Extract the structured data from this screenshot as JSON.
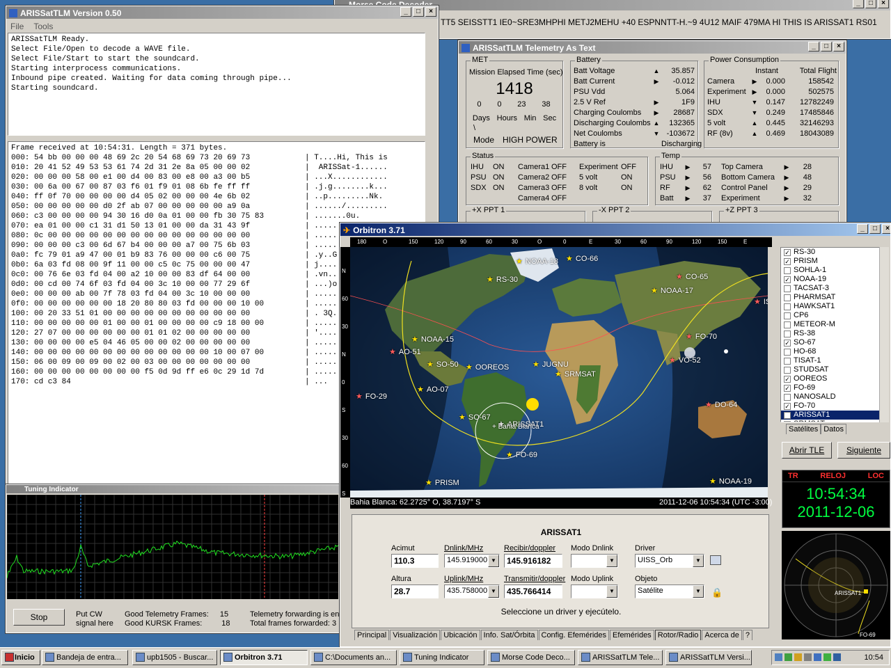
{
  "morse": {
    "title": "Morse Code Decoder",
    "text": "TT5 SEISSTT1 IE0~SRE3MHPHI METJ2MEHU +40 ESPNNTT-H.~9 4U12 MAIF 479MA HI THIS IS ARISSAT1 RS01"
  },
  "arissat": {
    "title": "ARISSatTLM Version 0.50",
    "menu": [
      "File",
      "Tools"
    ],
    "log": [
      "ARISSatTLM Ready.",
      "Select File/Open to decode a WAVE file.",
      "Select File/Start to start the soundcard.",
      "Starting interprocess communications.",
      "Inbound pipe created. Waiting for data coming through pipe...",
      "Starting soundcard."
    ],
    "hex": [
      {
        "h": "Frame received at 10:54:31. Length = 371 bytes.",
        "a": ""
      },
      {
        "h": "000: 54 bb 00 00 00 48 69 2c 20 54 68 69 73 20 69 73",
        "a": "T....Hi, This is"
      },
      {
        "h": "010: 20 41 52 49 53 53 61 74 2d 31 2e 8a 05 00 00 02",
        "a": " ARISSat-1......"
      },
      {
        "h": "020: 00 00 00 58 00 e1 00 d4 00 83 00 e8 00 a3 00 b5",
        "a": "...X............"
      },
      {
        "h": "030: 00 6a 00 67 00 87 03 f6 01 f9 01 08 6b fe ff ff",
        "a": ".j.g........k..."
      },
      {
        "h": "040: ff 0f 70 00 00 00 00 d4 05 02 00 00 00 4e 6b 02",
        "a": "..p.........Nk."
      },
      {
        "h": "050: 00 00 00 00 00 d0 2f ab 07 00 00 00 00 00 a9 0a",
        "a": "....../........."
      },
      {
        "h": "060: c3 00 00 00 00 94 30 16 d0 0a 01 00 00 fb 30 75 83",
        "a": ".......0u."
      },
      {
        "h": "070: ea 01 00 00 c1 31 d1 50 13 01 00 00 da 31 43 9f",
        "a": "....."
      },
      {
        "h": "080: 0c 00 00 00 00 00 00 00 00 00 00 00 00 00 00 00",
        "a": "....."
      },
      {
        "h": "090: 00 00 00 c3 00 6d 67 b4 00 00 00 a7 00 75 6b 03",
        "a": "....."
      },
      {
        "h": "0a0: fc 79 01 a9 47 00 01 b9 83 76 00 00 00 c6 00 75",
        "a": ".y..G"
      },
      {
        "h": "0b0: 6a 03 fd 08 00 9f 11 00 00 c5 0c 75 00 00 00 47",
        "a": "j...."
      },
      {
        "h": "0c0: 00 76 6e 03 fd 04 00 a2 10 00 00 83 df 64 00 00",
        "a": ".vn.."
      },
      {
        "h": "0d0: 00 cd 00 74 6f 03 fd 04 00 3c 10 00 00 77 29 6f",
        "a": "...)o"
      },
      {
        "h": "0e0: 00 00 00 ab 00 7f 78 03 fd 04 00 3c 10 00 00 00",
        "a": "....."
      },
      {
        "h": "0f0: 00 00 00 00 00 00 18 20 80 80 03 fd 00 00 00 10 00",
        "a": "....."
      },
      {
        "h": "100: 00 20 33 51 01 00 00 00 00 00 00 00 00 00 00 00",
        "a": ". 3Q."
      },
      {
        "h": "110: 00 00 00 00 00 01 00 00 01 00 00 00 00 c9 18 00 00",
        "a": "....."
      },
      {
        "h": "120: 27 07 00 00 00 00 00 00 01 01 02 00 00 00 00 00",
        "a": "'...."
      },
      {
        "h": "130: 00 00 00 00 e5 04 46 05 00 00 02 00 00 00 00 00",
        "a": "....."
      },
      {
        "h": "140: 00 00 00 00 00 00 00 00 00 00 00 00 00 10 00 07 00",
        "a": "....."
      },
      {
        "h": "150: 06 00 09 00 09 00 02 00 03 00 00 00 00 00 00 00",
        "a": "....."
      },
      {
        "h": "160: 00 00 00 00 00 00 00 00 f5 0d 9d ff e6 0c 29 1d 7d",
        "a": "....."
      },
      {
        "h": "170: cd c3 84",
        "a": "..."
      }
    ]
  },
  "tuning": {
    "title": "Tuning Indicator",
    "stop": "Stop",
    "put_cw": "Put CW signal here",
    "good_tlm_label": "Good Telemetry Frames:",
    "good_tlm": "15",
    "good_kursk_label": "Good KURSK Frames:",
    "good_kursk": "18",
    "fwd1": "Telemetry forwarding is en",
    "fwd2": "Total frames forwarded:  3"
  },
  "tlm": {
    "title": "ARISSatTLM Telemetry As Text",
    "met": {
      "label": "MET",
      "caption": "Mission Elapsed Time (sec)",
      "value": "1418",
      "nums": [
        "0",
        "0",
        "23",
        "38"
      ],
      "units": [
        "Days",
        "Hours",
        "Min",
        "Sec"
      ],
      "slash": "\\",
      "mode_label": "Mode",
      "mode": "HIGH POWER"
    },
    "battery": {
      "label": "Battery",
      "rows": [
        [
          "Batt Voltage",
          "▲",
          "35.857"
        ],
        [
          "Batt Current",
          "▶",
          "-0.012"
        ],
        [
          "PSU Vdd",
          "",
          "5.064"
        ],
        [
          "2.5 V Ref",
          "▶",
          "1F9"
        ],
        [
          "Charging Coulombs",
          "▶",
          "28687"
        ],
        [
          "Discharging Coulombs",
          "▲",
          "132365"
        ],
        [
          "Net Coulombs",
          "▼",
          "-103672"
        ],
        [
          "Battery is",
          "",
          "Discharging"
        ]
      ]
    },
    "power": {
      "label": "Power Consumption",
      "h1": "Instant",
      "h2": "Total Flight",
      "rows": [
        [
          "Camera",
          "▶",
          "0.000",
          "158542"
        ],
        [
          "Experiment",
          "▶",
          "0.000",
          "502575"
        ],
        [
          "IHU",
          "▼",
          "0.147",
          "12782249"
        ],
        [
          "SDX",
          "▼",
          "0.249",
          "17485846"
        ],
        [
          "5 volt",
          "▲",
          "0.445",
          "32146293"
        ],
        [
          "RF (8v)",
          "▲",
          "0.469",
          "18043089"
        ]
      ]
    },
    "status": {
      "label": "Status",
      "rows": [
        [
          "IHU",
          "ON",
          "Camera1",
          "OFF",
          "Experiment",
          "OFF"
        ],
        [
          "PSU",
          "ON",
          "Camera2",
          "OFF",
          "5 volt",
          "ON"
        ],
        [
          "SDX",
          "ON",
          "Camera3",
          "OFF",
          "8 volt",
          "ON"
        ],
        [
          "",
          "",
          "Camera4",
          "OFF",
          "",
          ""
        ]
      ]
    },
    "temp": {
      "label": "Temp",
      "rows": [
        [
          "IHU",
          "57",
          "Top Camera",
          "28"
        ],
        [
          "PSU",
          "56",
          "Bottom Camera",
          "48"
        ],
        [
          "RF",
          "62",
          "Control Panel",
          "29"
        ],
        [
          "Batt",
          "37",
          "Experiment",
          "32"
        ]
      ]
    },
    "ppt": [
      "+X PPT 1",
      "-X PPT 2",
      "+Z PPT 3"
    ]
  },
  "orbitron": {
    "title": "Orbitron 3.71",
    "top_scale": [
      "180",
      "O",
      "150",
      "120",
      "90",
      "60",
      "30",
      "O",
      "0",
      "E",
      "30",
      "60",
      "90",
      "120",
      "150",
      "E"
    ],
    "lat_scale": [
      "N",
      "60",
      "30",
      "N",
      "0",
      "S",
      "30",
      "60",
      "S"
    ],
    "sats": [
      {
        "n": "NOAA-18",
        "s": "★",
        "c": "#ffe000"
      },
      {
        "n": "CO-66",
        "s": "★",
        "c": "#ffe000"
      },
      {
        "n": "RS-30",
        "s": "★",
        "c": "#ffe000"
      },
      {
        "n": "CO-65",
        "s": "★",
        "c": "#ff5a5a"
      },
      {
        "n": "NOAA-17",
        "s": "★",
        "c": "#ffe000"
      },
      {
        "n": "ISS",
        "s": "★",
        "c": "#ff5a5a"
      },
      {
        "n": "NOAA-15",
        "s": "★",
        "c": "#ffe000"
      },
      {
        "n": "FO-70",
        "s": "★",
        "c": "#ff5a5a"
      },
      {
        "n": "AO-51",
        "s": "★",
        "c": "#ff5a5a"
      },
      {
        "n": "SO-50",
        "s": "★",
        "c": "#ffe000"
      },
      {
        "n": "OOREOS",
        "s": "★",
        "c": "#ffe000"
      },
      {
        "n": "JUGNU",
        "s": "★",
        "c": "#ffe000"
      },
      {
        "n": "SRMSAT",
        "s": "★",
        "c": "#ffe000"
      },
      {
        "n": "VO-52",
        "s": "★",
        "c": "#ff5a5a"
      },
      {
        "n": "AO-07",
        "s": "★",
        "c": "#ffe000"
      },
      {
        "n": "FO-29",
        "s": "★",
        "c": "#ff5a5a"
      },
      {
        "n": "DO-64",
        "s": "★",
        "c": "#ff5a5a"
      },
      {
        "n": "SO-67",
        "s": "★",
        "c": "#ffe000"
      },
      {
        "n": "ARISSAT1",
        "s": "★",
        "c": "#ffffff"
      },
      {
        "n": "FO-69",
        "s": "★",
        "c": "#ffe000"
      },
      {
        "n": "PRISM",
        "s": "★",
        "c": "#ffe000"
      },
      {
        "n": "NOAA-19",
        "s": "★",
        "c": "#ffe000"
      }
    ],
    "qth": "+ Bahia Blanca",
    "loc_line": "Bahia Blanca: 62.2725° O, 38.7197° S",
    "time_line": "2011-12-06 10:54:34 (UTC -3:00)",
    "list": [
      [
        "RS-30",
        true
      ],
      [
        "PRISM",
        true
      ],
      [
        "SOHLA-1",
        false
      ],
      [
        "NOAA-19",
        true
      ],
      [
        "TACSAT-3",
        false
      ],
      [
        "PHARMSAT",
        false
      ],
      [
        "HAWKSAT1",
        false
      ],
      [
        "CP6",
        false
      ],
      [
        "METEOR-M",
        false
      ],
      [
        "RS-38",
        false
      ],
      [
        "SO-67",
        true
      ],
      [
        "HO-68",
        false
      ],
      [
        "TISAT-1",
        false
      ],
      [
        "STUDSAT",
        false
      ],
      [
        "OOREOS",
        true
      ],
      [
        "FO-69",
        true
      ],
      [
        "NANOSALD",
        false
      ],
      [
        "FO-70",
        true
      ],
      [
        "ARISSAT1",
        true
      ],
      [
        "SRMSAT",
        false
      ]
    ],
    "list_tabs": [
      "Satélites",
      "Datos"
    ],
    "abrir": "Abrir TLE",
    "sig": "Siguiente",
    "clock": {
      "tr": "TR",
      "reloj": "RELOJ",
      "loc": "LOC",
      "time": "10:54:34",
      "date": "2011-12-06"
    },
    "radar_labels": [
      "ARISSAT1",
      "FO-69"
    ],
    "panel": {
      "sat": "ARISSAT1",
      "acimut_l": "Acimut",
      "acimut": "110.3",
      "dn_l": "Dnlink/MHz",
      "dn": "145.919000",
      "rec_l": "Recibir/doppler",
      "rec": "145.916182",
      "modo_dn_l": "Modo Dnlink",
      "driver_l": "Driver",
      "driver": "UISS_Orb",
      "alt_l": "Altura",
      "alt": "28.7",
      "up_l": "Uplink/MHz",
      "up": "435.758000",
      "tx_l": "Transmitir/doppler",
      "tx": "435.766414",
      "modo_up_l": "Modo Uplink",
      "obj_l": "Objeto",
      "obj": "Satélite",
      "msg": "Seleccione un driver y ejecútelo."
    },
    "tabs": [
      "Principal",
      "Visualización",
      "Ubicación",
      "Info. Sat/Órbita",
      "Config. Efemérides",
      "Efemérides",
      "Rotor/Radio",
      "Acerca de",
      "?"
    ]
  },
  "taskbar": {
    "start": "Inicio",
    "items": [
      "Bandeja de entra...",
      "upb1505 - Buscar...",
      "Orbitron 3.71",
      "C:\\Documents an...",
      "Tuning Indicator",
      "Morse Code Deco...",
      "ARISSatTLM Tele...",
      "ARISSatTLM Versi..."
    ],
    "clock": "10:54"
  },
  "colors": {
    "title_active": "#0a246a",
    "title_inactive": "#808080",
    "clock_green": "#00ff40",
    "track": "#f0e020"
  }
}
